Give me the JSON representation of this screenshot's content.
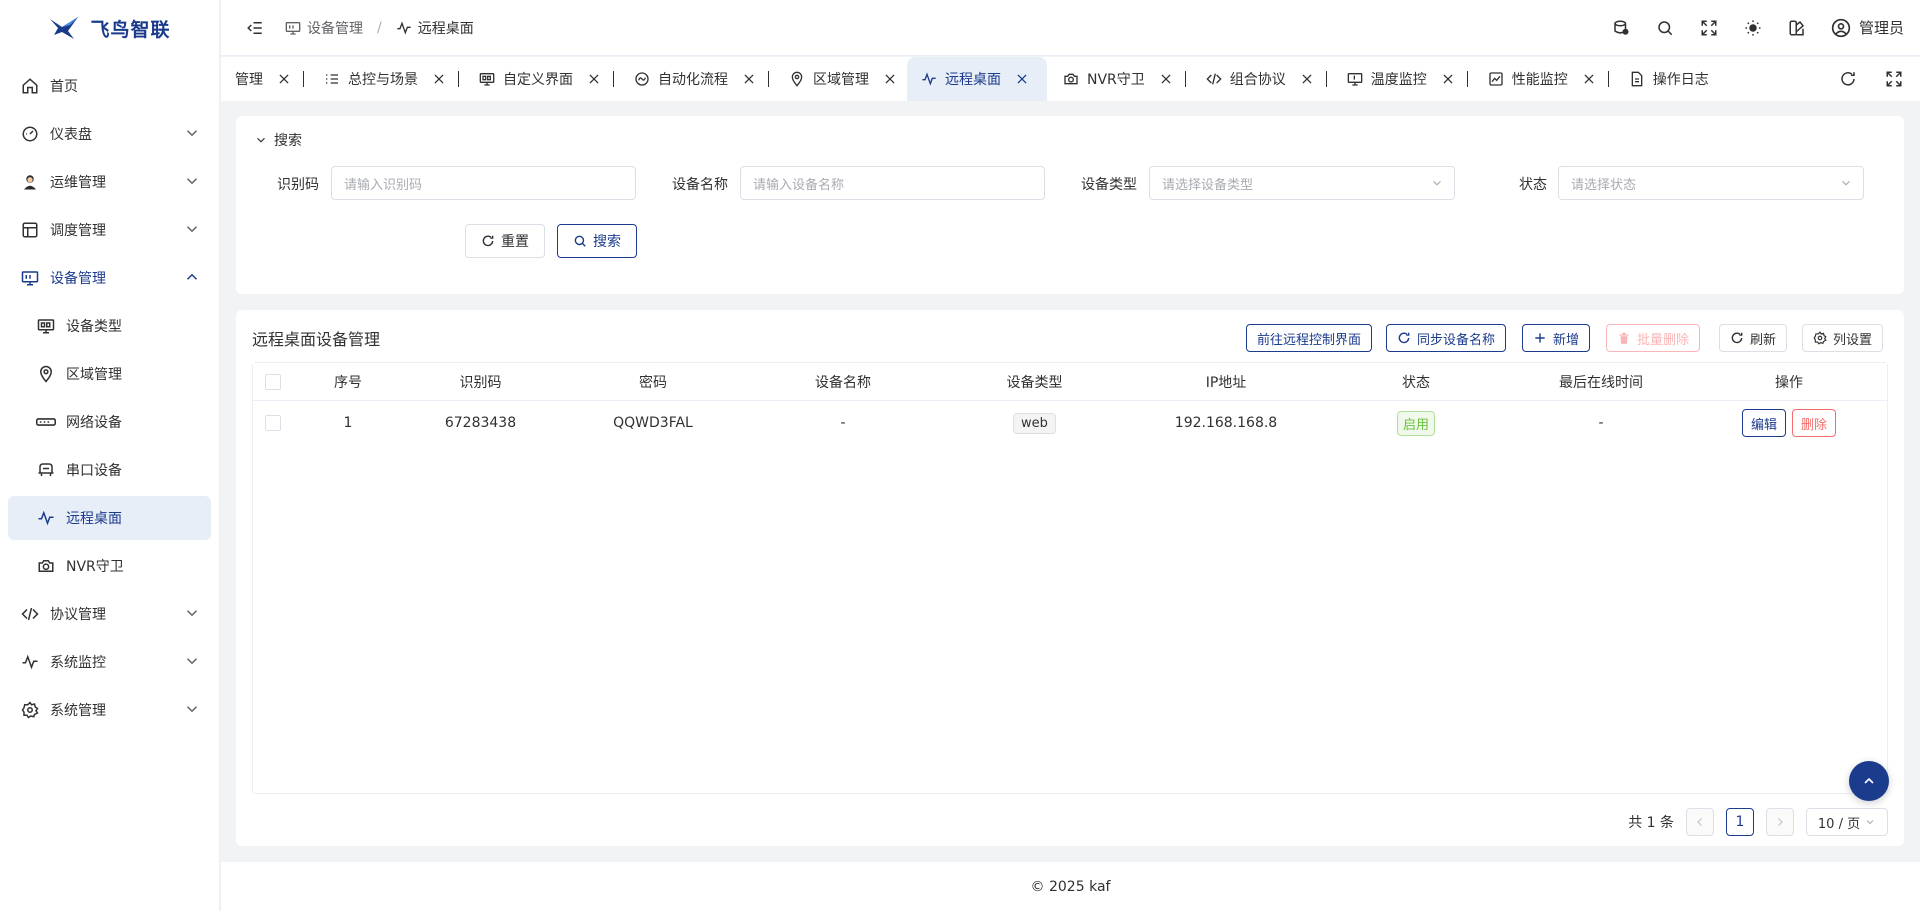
{
  "brand": {
    "name": "飞鸟智联",
    "accent": "#1b3b8c"
  },
  "sidebar": {
    "items": [
      {
        "label": "首页",
        "icon": "home-icon"
      },
      {
        "label": "仪表盘",
        "icon": "dashboard-icon"
      },
      {
        "label": "运维管理",
        "icon": "ops-avatar-icon"
      },
      {
        "label": "调度管理",
        "icon": "schedule-icon"
      },
      {
        "label": "设备管理",
        "icon": "device-icon"
      },
      {
        "label": "设备类型",
        "icon": "monitor-icon"
      },
      {
        "label": "区域管理",
        "icon": "location-icon"
      },
      {
        "label": "网络设备",
        "icon": "network-icon"
      },
      {
        "label": "串口设备",
        "icon": "serial-icon"
      },
      {
        "label": "远程桌面",
        "icon": "pulse-icon"
      },
      {
        "label": "NVR守卫",
        "icon": "camera-icon"
      },
      {
        "label": "协议管理",
        "icon": "code-icon"
      },
      {
        "label": "系统监控",
        "icon": "pulse-icon"
      },
      {
        "label": "系统管理",
        "icon": "gear-icon"
      }
    ]
  },
  "header": {
    "breadcrumb": [
      "设备管理",
      "远程桌面"
    ],
    "user": "管理员"
  },
  "tabs": [
    {
      "label": "管理"
    },
    {
      "label": "总控与场景"
    },
    {
      "label": "自定义界面"
    },
    {
      "label": "自动化流程"
    },
    {
      "label": "区域管理"
    },
    {
      "label": "远程桌面"
    },
    {
      "label": "NVR守卫"
    },
    {
      "label": "组合协议"
    },
    {
      "label": "温度监控"
    },
    {
      "label": "性能监控"
    },
    {
      "label": "操作日志"
    }
  ],
  "search": {
    "title": "搜索",
    "fields": [
      {
        "label": "识别码",
        "placeholder": "请输入识别码"
      },
      {
        "label": "设备名称",
        "placeholder": "请输入设备名称"
      },
      {
        "label": "设备类型",
        "placeholder": "请选择设备类型"
      },
      {
        "label": "状态",
        "placeholder": "请选择状态"
      }
    ],
    "reset_label": "重置",
    "search_label": "搜索"
  },
  "table": {
    "title": "远程桌面设备管理",
    "toolbar": {
      "goto_remote": "前往远程控制界面",
      "sync_names": "同步设备名称",
      "add": "新增",
      "batch_delete": "批量删除",
      "refresh": "刷新",
      "columns": "列设置"
    },
    "columns": [
      "序号",
      "识别码",
      "密码",
      "设备名称",
      "设备类型",
      "IP地址",
      "状态",
      "最后在线时间",
      "操作"
    ],
    "rows": [
      {
        "index": "1",
        "code": "67283438",
        "password": "QQWD3FAL",
        "name": "-",
        "type": "web",
        "ip": "192.168.168.8",
        "status": "启用",
        "last_online": "-",
        "edit": "编辑",
        "delete": "删除"
      }
    ]
  },
  "pagination": {
    "total": "共 1 条",
    "page": "1",
    "size": "10 / 页"
  },
  "footer": "© 2025 kaf"
}
